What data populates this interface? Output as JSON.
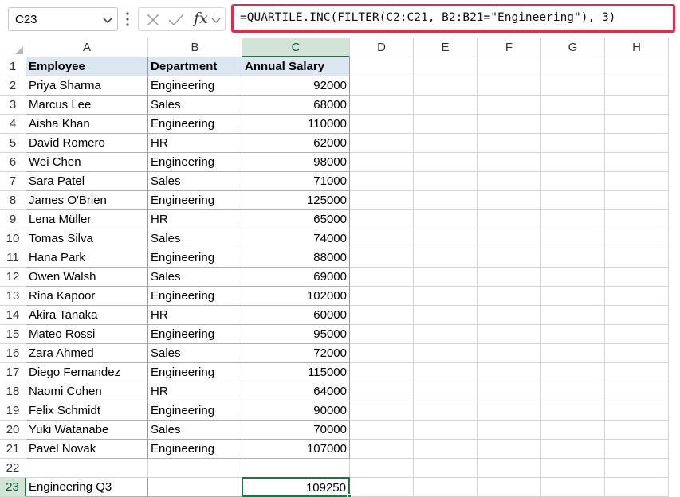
{
  "name_box": {
    "value": "C23"
  },
  "formula_bar": {
    "fx_label": "fx",
    "formula": "=QUARTILE.INC(FILTER(C2:C21, B2:B21=\"Engineering\"), 3)"
  },
  "columns": [
    "A",
    "B",
    "C",
    "D",
    "E",
    "F",
    "G",
    "H"
  ],
  "selected_column": "C",
  "selected_row": 23,
  "header_row": [
    "Employee",
    "Department",
    "Annual Salary"
  ],
  "rows": [
    [
      "Priya Sharma",
      "Engineering",
      "92000"
    ],
    [
      "Marcus Lee",
      "Sales",
      "68000"
    ],
    [
      "Aisha Khan",
      "Engineering",
      "110000"
    ],
    [
      "David Romero",
      "HR",
      "62000"
    ],
    [
      "Wei Chen",
      "Engineering",
      "98000"
    ],
    [
      "Sara Patel",
      "Sales",
      "71000"
    ],
    [
      "James O'Brien",
      "Engineering",
      "125000"
    ],
    [
      "Lena Müller",
      "HR",
      "65000"
    ],
    [
      "Tomas Silva",
      "Sales",
      "74000"
    ],
    [
      "Hana Park",
      "Engineering",
      "88000"
    ],
    [
      "Owen Walsh",
      "Sales",
      "69000"
    ],
    [
      "Rina Kapoor",
      "Engineering",
      "102000"
    ],
    [
      "Akira Tanaka",
      "HR",
      "60000"
    ],
    [
      "Mateo Rossi",
      "Engineering",
      "95000"
    ],
    [
      "Zara Ahmed",
      "Sales",
      "72000"
    ],
    [
      "Diego Fernandez",
      "Engineering",
      "115000"
    ],
    [
      "Naomi Cohen",
      "HR",
      "64000"
    ],
    [
      "Felix Schmidt",
      "Engineering",
      "90000"
    ],
    [
      "Yuki Watanabe",
      "Sales",
      "70000"
    ],
    [
      "Pavel Novak",
      "Engineering",
      "107000"
    ]
  ],
  "summary_row": [
    "Engineering Q3",
    "",
    "109250"
  ],
  "row_numbers": [
    1,
    2,
    3,
    4,
    5,
    6,
    7,
    8,
    9,
    10,
    11,
    12,
    13,
    14,
    15,
    16,
    17,
    18,
    19,
    20,
    21,
    22,
    23
  ],
  "colors": {
    "selection": "#217346",
    "formula_highlight": "#d6304f",
    "header_fill": "#dce6f1"
  }
}
